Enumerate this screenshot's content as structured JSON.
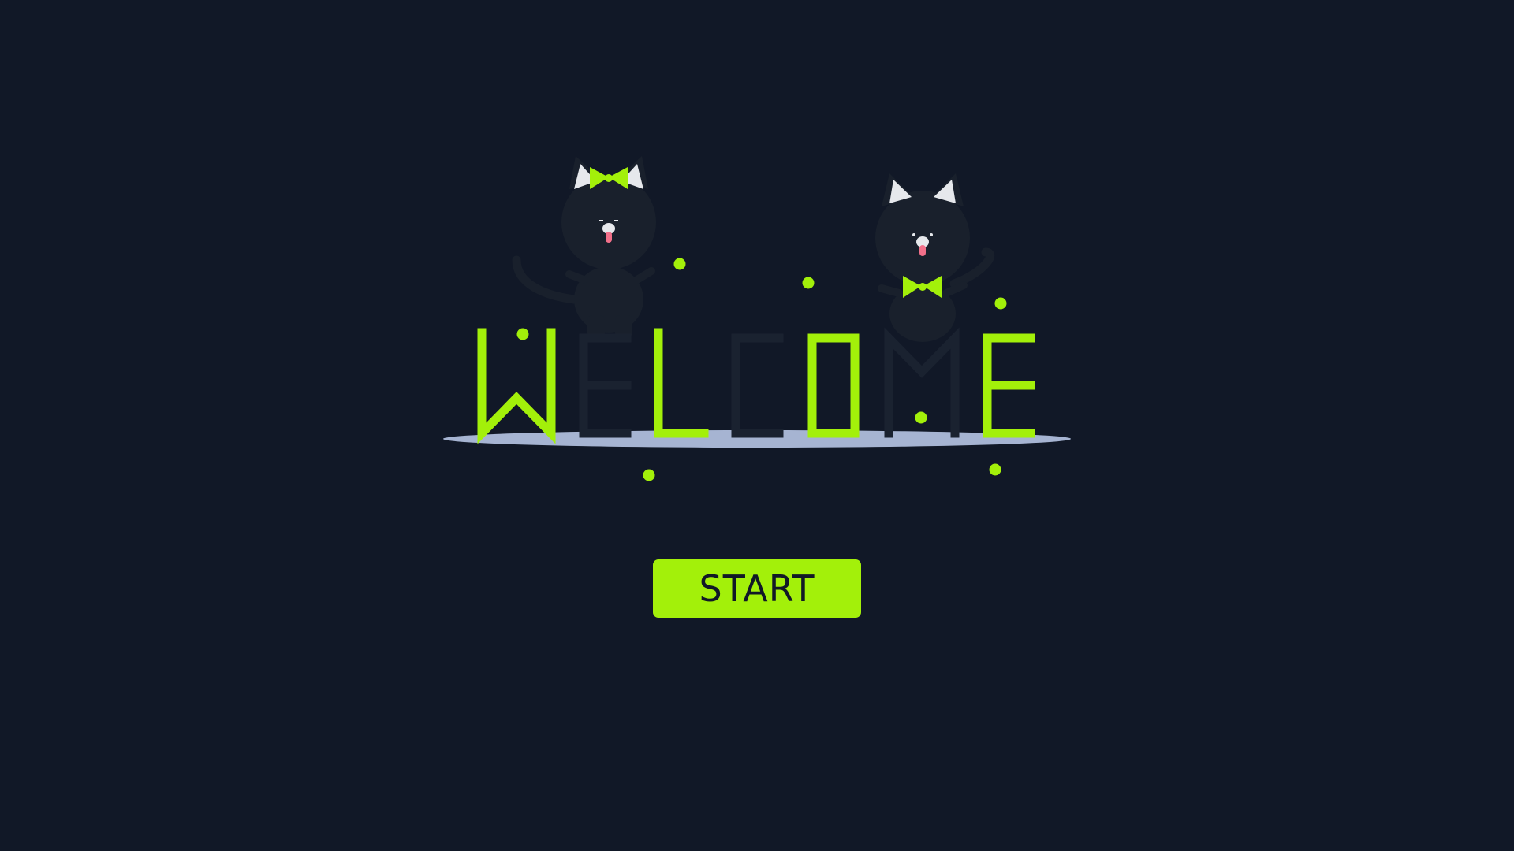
{
  "screen": {
    "title": "WELCOME",
    "start_label": "START"
  },
  "colors": {
    "background": "#111827",
    "accent": "#a3f00a",
    "dim_letter": "#1a2230",
    "cat_body": "#19202c",
    "platform": "#a6b4d2",
    "ear": "#e6e8ec",
    "tongue": "#f2708a"
  },
  "title_letters": [
    {
      "char": "W",
      "lit": true
    },
    {
      "char": "E",
      "lit": false
    },
    {
      "char": "L",
      "lit": true
    },
    {
      "char": "C",
      "lit": false
    },
    {
      "char": "O",
      "lit": true
    },
    {
      "char": "M",
      "lit": false
    },
    {
      "char": "E",
      "lit": true
    }
  ],
  "cats": [
    {
      "accessory": "bow-on-head"
    },
    {
      "accessory": "bow-tie"
    }
  ]
}
